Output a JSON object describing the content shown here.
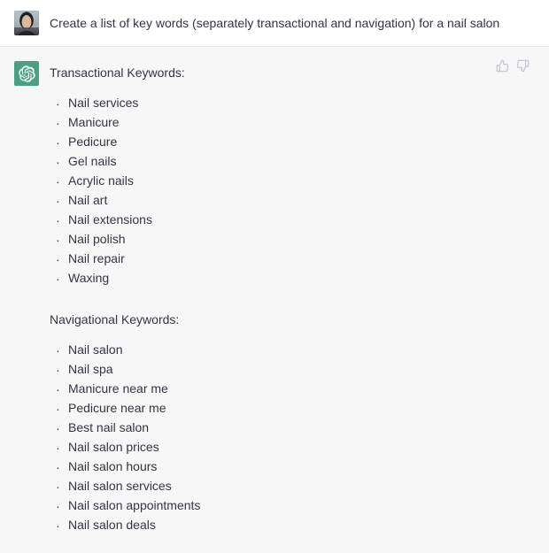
{
  "conversation": {
    "user_message": {
      "avatar": "user-photo-avatar",
      "text": "Create a list of key words (separately transactional and navigation) for a nail salon"
    },
    "assistant_message": {
      "avatar": "chatgpt-logo-icon",
      "sections": [
        {
          "heading": "Transactional Keywords:",
          "items": [
            "Nail services",
            "Manicure",
            "Pedicure",
            "Gel nails",
            "Acrylic nails",
            "Nail art",
            "Nail extensions",
            "Nail polish",
            "Nail repair",
            "Waxing"
          ]
        },
        {
          "heading": "Navigational Keywords:",
          "items": [
            "Nail salon",
            "Nail spa",
            "Manicure near me",
            "Pedicure near me",
            "Best nail salon",
            "Nail salon prices",
            "Nail salon hours",
            "Nail salon services",
            "Nail salon appointments",
            "Nail salon deals"
          ]
        }
      ],
      "bullet_glyph": "·",
      "feedback": {
        "thumbs_up": "thumbs-up-icon",
        "thumbs_down": "thumbs-down-icon"
      }
    }
  },
  "colors": {
    "user_background": "#ffffff",
    "assistant_background": "#f7f7f8",
    "divider": "#e6e6e8",
    "text": "#343541",
    "assistant_avatar": "#4aa181",
    "feedback_icon": "#c5c5d2"
  }
}
